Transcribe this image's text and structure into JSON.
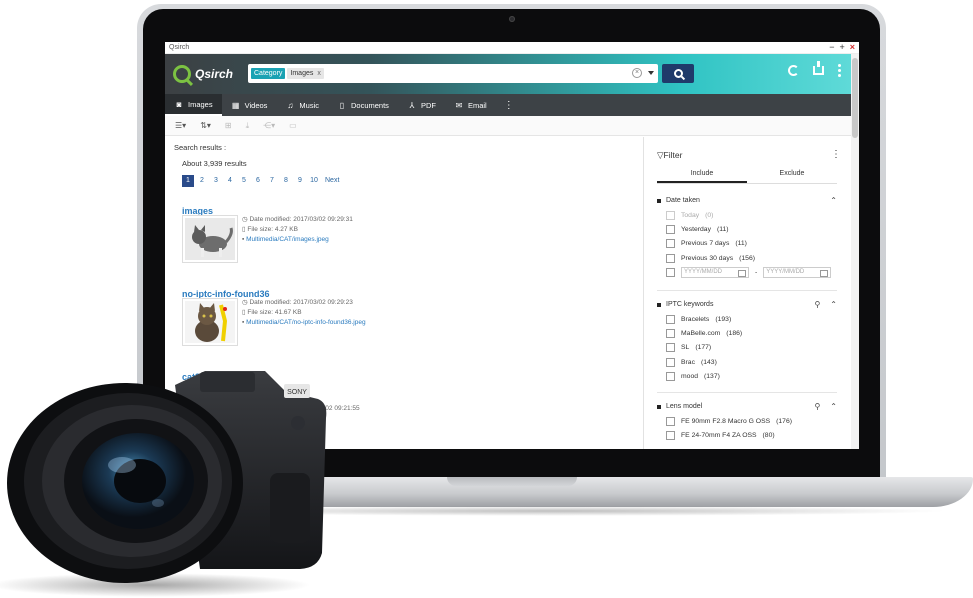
{
  "window": {
    "title": "Qsirch"
  },
  "app": {
    "logo_text": "Qsirch"
  },
  "search": {
    "category_label": "Category",
    "category_value": "Images",
    "chip_close": "x",
    "clear_icon": "clear-icon",
    "button_icon": "magnifier-icon"
  },
  "nav": {
    "items": [
      {
        "label": "Images",
        "icon": "camera-icon",
        "active": true
      },
      {
        "label": "Videos",
        "icon": "film-icon"
      },
      {
        "label": "Music",
        "icon": "music-note-icon"
      },
      {
        "label": "Documents",
        "icon": "document-icon"
      },
      {
        "label": "PDF",
        "icon": "pdf-icon"
      },
      {
        "label": "Email",
        "icon": "envelope-icon"
      }
    ]
  },
  "results": {
    "label": "Search results :",
    "count": "About 3,939 results",
    "pages": [
      "1",
      "2",
      "3",
      "4",
      "5",
      "6",
      "7",
      "8",
      "9",
      "10"
    ],
    "next": "Next",
    "items": [
      {
        "title": "images",
        "date": "Date modified: 2017/03/02 09:29:31",
        "size": "File size: 4.27 KB",
        "path": "Multimedia/CAT/images.jpeg"
      },
      {
        "title": "no-iptc-info-found36",
        "date": "Date modified: 2017/03/02 09:29:23",
        "size": "File size: 41.67 KB",
        "path": "Multimedia/CAT/no-iptc-info-found36.jpeg"
      },
      {
        "title": "cat8",
        "date": "2017/03/02 09:21:55"
      }
    ]
  },
  "filter": {
    "title": "Filter",
    "tabs": [
      "Include",
      "Exclude"
    ],
    "date_taken": {
      "title": "Date taken",
      "options": [
        {
          "label": "Today",
          "count": "(0)",
          "disabled": true
        },
        {
          "label": "Yesterday",
          "count": "(11)"
        },
        {
          "label": "Previous 7 days",
          "count": "(11)"
        },
        {
          "label": "Previous 30 days",
          "count": "(156)"
        }
      ],
      "from_placeholder": "YYYY/MM/DD",
      "to_placeholder": "YYYY/MM/DD",
      "range_sep": "-"
    },
    "iptc": {
      "title": "IPTC keywords",
      "options": [
        {
          "label": "Bracelets",
          "count": "(193)"
        },
        {
          "label": "MaBelle.com",
          "count": "(186)"
        },
        {
          "label": "SL",
          "count": "(177)"
        },
        {
          "label": "Brac",
          "count": "(143)"
        },
        {
          "label": "mood",
          "count": "(137)"
        }
      ]
    },
    "lens": {
      "title": "Lens model",
      "options": [
        {
          "label": "FE 90mm F2.8 Macro G OSS",
          "count": "(176)"
        },
        {
          "label": "FE 24-70mm F4 ZA OSS",
          "count": "(80)"
        }
      ]
    }
  },
  "camera": {
    "brand": "SONY"
  },
  "colors": {
    "topbar_dark": "#3c4043",
    "topbar_teal": "#2fc3c3",
    "navbar": "#3d4246",
    "search_button": "#1f3a6a",
    "category_chip": "#1aa2b3",
    "link": "#2a7bbf",
    "logo_green": "#7cc242"
  }
}
